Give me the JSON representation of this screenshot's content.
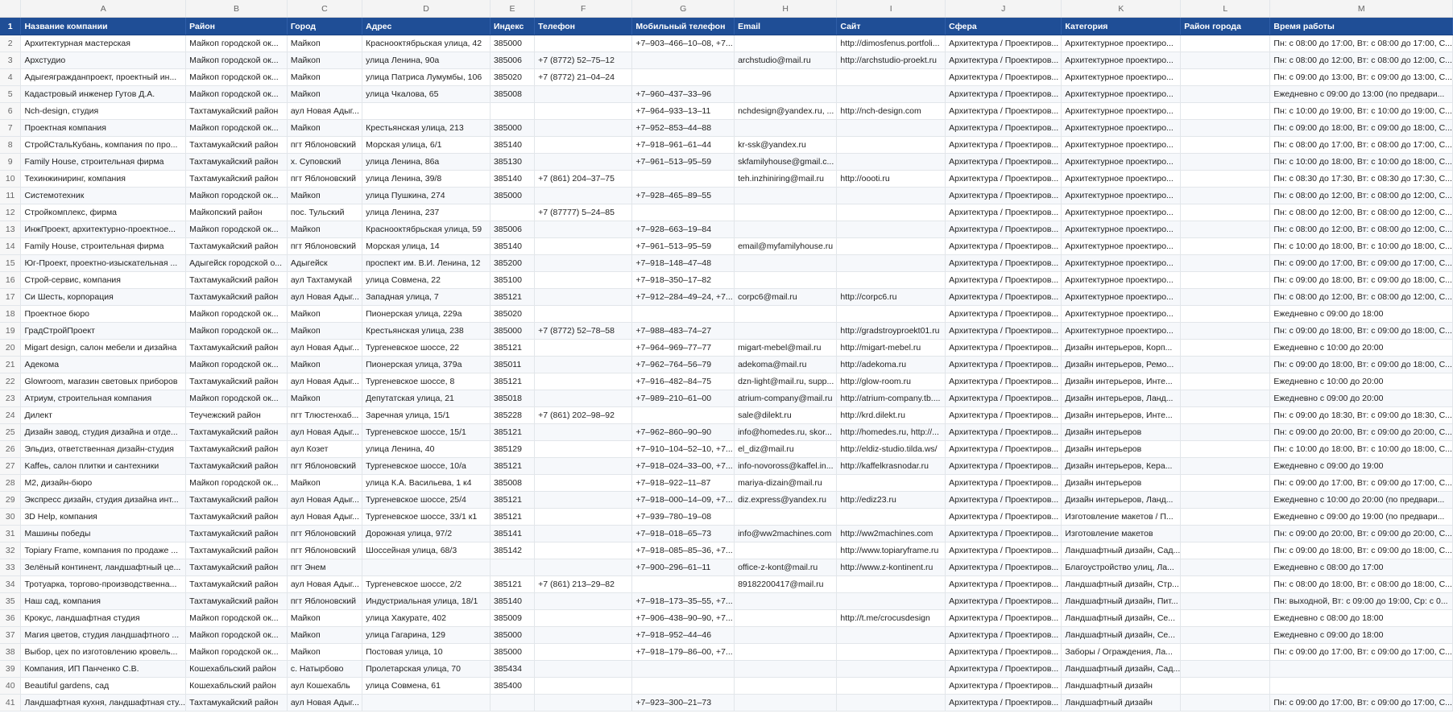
{
  "columns": [
    "A",
    "B",
    "C",
    "D",
    "E",
    "F",
    "G",
    "H",
    "I",
    "J",
    "K",
    "L",
    "M"
  ],
  "header_row_number": "1",
  "headers": [
    "Название компании",
    "Район",
    "Город",
    "Адрес",
    "Индекс",
    "Телефон",
    "Мобильный телефон",
    "Email",
    "Сайт",
    "Сфера",
    "Категория",
    "Район города",
    "Время работы"
  ],
  "rows": [
    [
      "2",
      "Архитектурная мастерская",
      "Майкоп городской ок...",
      "Майкоп",
      "Краснооктябрьская улица, 42",
      "385000",
      "",
      "+7‒903‒466‒10‒08, +7...",
      "",
      "http://dimosfenus.portfoli...",
      "Архитектура / Проектиров...",
      "Архитектурное проектиро...",
      "",
      "Пн: с 08:00 до 17:00, Вт: с 08:00 до 17:00, С..."
    ],
    [
      "3",
      "Архстудио",
      "Майкоп городской ок...",
      "Майкоп",
      "улица Ленина, 90а",
      "385006",
      "+7 (8772) 52‒75‒12",
      "",
      "archstudio@mail.ru",
      "http://archstudio-proekt.ru",
      "Архитектура / Проектиров...",
      "Архитектурное проектиро...",
      "",
      "Пн: с 08:00 до 12:00, Вт: с 08:00 до 12:00, С..."
    ],
    [
      "4",
      "Адыгеягражданпроект, проектный ин...",
      "Майкоп городской ок...",
      "Майкоп",
      "улица Патриса Лумумбы, 106",
      "385020",
      "+7 (8772) 21‒04‒24",
      "",
      "",
      "",
      "Архитектура / Проектиров...",
      "Архитектурное проектиро...",
      "",
      "Пн: с 09:00 до 13:00, Вт: с 09:00 до 13:00, С..."
    ],
    [
      "5",
      "Кадастровый инженер Гутов Д.А.",
      "Майкоп городской ок...",
      "Майкоп",
      "улица Чкалова, 65",
      "385008",
      "",
      "+7‒960‒437‒33‒96",
      "",
      "",
      "Архитектура / Проектиров...",
      "Архитектурное проектиро...",
      "",
      "Ежедневно с 09:00 до 13:00 (по предвари..."
    ],
    [
      "6",
      "Nch-design, студия",
      "Тахтамукайский район",
      "аул Новая Адыг...",
      "",
      "",
      "",
      "+7‒964‒933‒13‒11",
      "nchdesign@yandex.ru, ...",
      "http://nch-design.com",
      "Архитектура / Проектиров...",
      "Архитектурное проектиро...",
      "",
      "Пн: с 10:00 до 19:00, Вт: с 10:00 до 19:00, С..."
    ],
    [
      "7",
      "Проектная компания",
      "Майкоп городской ок...",
      "Майкоп",
      "Крестьянская улица, 213",
      "385000",
      "",
      "+7‒952‒853‒44‒88",
      "",
      "",
      "Архитектура / Проектиров...",
      "Архитектурное проектиро...",
      "",
      "Пн: с 09:00 до 18:00, Вт: с 09:00 до 18:00, С..."
    ],
    [
      "8",
      "СтройСтальКубань, компания по про...",
      "Тахтамукайский район",
      "пгт Яблоновский",
      "Морская улица, 6/1",
      "385140",
      "",
      "+7‒918‒961‒61‒44",
      "kr-ssk@yandex.ru",
      "",
      "Архитектура / Проектиров...",
      "Архитектурное проектиро...",
      "",
      "Пн: с 08:00 до 17:00, Вт: с 08:00 до 17:00, С..."
    ],
    [
      "9",
      "Family House, строительная фирма",
      "Тахтамукайский район",
      "х. Суповский",
      "улица Ленина, 86а",
      "385130",
      "",
      "+7‒961‒513‒95‒59",
      "skfamilyhouse@gmail.c...",
      "",
      "Архитектура / Проектиров...",
      "Архитектурное проектиро...",
      "",
      "Пн: с 10:00 до 18:00, Вт: с 10:00 до 18:00, С..."
    ],
    [
      "10",
      "Техинжиниринг, компания",
      "Тахтамукайский район",
      "пгт Яблоновский",
      "улица Ленина, 39/8",
      "385140",
      "+7 (861) 204‒37‒75",
      "",
      "teh.inzhiniring@mail.ru",
      "http://oooti.ru",
      "Архитектура / Проектиров...",
      "Архитектурное проектиро...",
      "",
      "Пн: с 08:30 до 17:30, Вт: с 08:30 до 17:30, С..."
    ],
    [
      "11",
      "Системотехник",
      "Майкоп городской ок...",
      "Майкоп",
      "улица Пушкина, 274",
      "385000",
      "",
      "+7‒928‒465‒89‒55",
      "",
      "",
      "Архитектура / Проектиров...",
      "Архитектурное проектиро...",
      "",
      "Пн: с 08:00 до 12:00, Вт: с 08:00 до 12:00, С..."
    ],
    [
      "12",
      "Стройкомплекс, фирма",
      "Майкопский район",
      "пос. Тульский",
      "улица Ленина, 237",
      "",
      "+7 (87777) 5‒24‒85",
      "",
      "",
      "",
      "Архитектура / Проектиров...",
      "Архитектурное проектиро...",
      "",
      "Пн: с 08:00 до 12:00, Вт: с 08:00 до 12:00, С..."
    ],
    [
      "13",
      "ИнжПроект, архитектурно-проектное...",
      "Майкоп городской ок...",
      "Майкоп",
      "Краснооктябрьская улица, 59",
      "385006",
      "",
      "+7‒928‒663‒19‒84",
      "",
      "",
      "Архитектура / Проектиров...",
      "Архитектурное проектиро...",
      "",
      "Пн: с 08:00 до 12:00, Вт: с 08:00 до 12:00, С..."
    ],
    [
      "14",
      "Family House, строительная фирма",
      "Тахтамукайский район",
      "пгт Яблоновский",
      "Морская улица, 14",
      "385140",
      "",
      "+7‒961‒513‒95‒59",
      "email@myfamilyhouse.ru",
      "",
      "Архитектура / Проектиров...",
      "Архитектурное проектиро...",
      "",
      "Пн: с 10:00 до 18:00, Вт: с 10:00 до 18:00, С..."
    ],
    [
      "15",
      "Юг-Проект, проектно-изыскательная ...",
      "Адыгейск городской о...",
      "Адыгейск",
      "проспект им. В.И. Ленина, 12",
      "385200",
      "",
      "+7‒918‒148‒47‒48",
      "",
      "",
      "Архитектура / Проектиров...",
      "Архитектурное проектиро...",
      "",
      "Пн: с 09:00 до 17:00, Вт: с 09:00 до 17:00, С..."
    ],
    [
      "16",
      "Строй-сервис, компания",
      "Тахтамукайский район",
      "аул Тахтамукай",
      "улица Совмена, 22",
      "385100",
      "",
      "+7‒918‒350‒17‒82",
      "",
      "",
      "Архитектура / Проектиров...",
      "Архитектурное проектиро...",
      "",
      "Пн: с 09:00 до 18:00, Вт: с 09:00 до 18:00, С..."
    ],
    [
      "17",
      "Си Шесть, корпорация",
      "Тахтамукайский район",
      "аул Новая Адыг...",
      "Западная улица, 7",
      "385121",
      "",
      "+7‒912‒284‒49‒24, +7...",
      "corpc6@mail.ru",
      "http://corpc6.ru",
      "Архитектура / Проектиров...",
      "Архитектурное проектиро...",
      "",
      "Пн: с 08:00 до 12:00, Вт: с 08:00 до 12:00, С..."
    ],
    [
      "18",
      "Проектное бюро",
      "Майкоп городской ок...",
      "Майкоп",
      "Пионерская улица, 229а",
      "385020",
      "",
      "",
      "",
      "",
      "Архитектура / Проектиров...",
      "Архитектурное проектиро...",
      "",
      "Ежедневно с 09:00 до 18:00"
    ],
    [
      "19",
      "ГрадСтройПроект",
      "Майкоп городской ок...",
      "Майкоп",
      "Крестьянская улица, 238",
      "385000",
      "+7 (8772) 52‒78‒58",
      "+7‒988‒483‒74‒27",
      "",
      "http://gradstroyproekt01.ru",
      "Архитектура / Проектиров...",
      "Архитектурное проектиро...",
      "",
      "Пн: с 09:00 до 18:00, Вт: с 09:00 до 18:00, С..."
    ],
    [
      "20",
      "Migart design, салон мебели и дизайна",
      "Тахтамукайский район",
      "аул Новая Адыг...",
      "Тургеневское шоссе, 22",
      "385121",
      "",
      "+7‒964‒969‒77‒77",
      "migart-mebel@mail.ru",
      "http://migart-mebel.ru",
      "Архитектура / Проектиров...",
      "Дизайн интерьеров, Корп...",
      "",
      "Ежедневно с 10:00 до 20:00"
    ],
    [
      "21",
      "Адекома",
      "Майкоп городской ок...",
      "Майкоп",
      "Пионерская улица, 379а",
      "385011",
      "",
      "+7‒962‒764‒56‒79",
      "adekoma@mail.ru",
      "http://adekoma.ru",
      "Архитектура / Проектиров...",
      "Дизайн интерьеров, Ремо...",
      "",
      "Пн: с 09:00 до 18:00, Вт: с 09:00 до 18:00, С..."
    ],
    [
      "22",
      "Glowroom, магазин световых приборов",
      "Тахтамукайский район",
      "аул Новая Адыг...",
      "Тургеневское шоссе, 8",
      "385121",
      "",
      "+7‒916‒482‒84‒75",
      "dzn-light@mail.ru, supp...",
      "http://glow-room.ru",
      "Архитектура / Проектиров...",
      "Дизайн интерьеров, Инте...",
      "",
      "Ежедневно с 10:00 до 20:00"
    ],
    [
      "23",
      "Атриум, строительная компания",
      "Майкоп городской ок...",
      "Майкоп",
      "Депутатская улица, 21",
      "385018",
      "",
      "+7‒989‒210‒61‒00",
      "atrium-company@mail.ru",
      "http://atrium-company.tb....",
      "Архитектура / Проектиров...",
      "Дизайн интерьеров, Ланд...",
      "",
      "Ежедневно с 09:00 до 20:00"
    ],
    [
      "24",
      "Дилект",
      "Теучежский район",
      "пгт Тлюстенхаб...",
      "Заречная улица, 15/1",
      "385228",
      "+7 (861) 202‒98‒92",
      "",
      "sale@dilekt.ru",
      "http://krd.dilekt.ru",
      "Архитектура / Проектиров...",
      "Дизайн интерьеров, Инте...",
      "",
      "Пн: с 09:00 до 18:30, Вт: с 09:00 до 18:30, С..."
    ],
    [
      "25",
      "Дизайн завод, студия дизайна и отде...",
      "Тахтамукайский район",
      "аул Новая Адыг...",
      "Тургеневское шоссе, 15/1",
      "385121",
      "",
      "+7‒962‒860‒90‒90",
      "info@homedes.ru, skor...",
      "http://homedes.ru, http://...",
      "Архитектура / Проектиров...",
      "Дизайн интерьеров",
      "",
      "Пн: с 09:00 до 20:00, Вт: с 09:00 до 20:00, С..."
    ],
    [
      "26",
      "Эльдиз, ответственная дизайн-студия",
      "Тахтамукайский район",
      "аул Козет",
      "улица Ленина, 40",
      "385129",
      "",
      "+7‒910‒104‒52‒10, +7...",
      "el_diz@mail.ru",
      "http://eldiz-studio.tilda.ws/",
      "Архитектура / Проектиров...",
      "Дизайн интерьеров",
      "",
      "Пн: с 10:00 до 18:00, Вт: с 10:00 до 18:00, С..."
    ],
    [
      "27",
      "Kaffeь, салон плитки и сантехники",
      "Тахтамукайский район",
      "пгт Яблоновский",
      "Тургеневское шоссе, 10/а",
      "385121",
      "",
      "+7‒918‒024‒33‒00, +7...",
      "info-novoross@kaffel.in...",
      "http://kaffelkrasnodar.ru",
      "Архитектура / Проектиров...",
      "Дизайн интерьеров, Кера...",
      "",
      "Ежедневно с 09:00 до 19:00"
    ],
    [
      "28",
      "М2, дизайн-бюро",
      "Майкоп городской ок...",
      "Майкоп",
      "улица К.А. Васильева, 1 к4",
      "385008",
      "",
      "+7‒918‒922‒11‒87",
      "mariya-dizain@mail.ru",
      "",
      "Архитектура / Проектиров...",
      "Дизайн интерьеров",
      "",
      "Пн: с 09:00 до 17:00, Вт: с 09:00 до 17:00, С..."
    ],
    [
      "29",
      "Экспресс дизайн, студия дизайна инт...",
      "Тахтамукайский район",
      "аул Новая Адыг...",
      "Тургеневское шоссе, 25/4",
      "385121",
      "",
      "+7‒918‒000‒14‒09, +7...",
      "diz.express@yandex.ru",
      "http://ediz23.ru",
      "Архитектура / Проектиров...",
      "Дизайн интерьеров, Ланд...",
      "",
      "Ежедневно с 10:00 до 20:00 (по предвари..."
    ],
    [
      "30",
      "3D Help, компания",
      "Тахтамукайский район",
      "аул Новая Адыг...",
      "Тургеневское шоссе, 33/1 к1",
      "385121",
      "",
      "+7‒939‒780‒19‒08",
      "",
      "",
      "Архитектура / Проектиров...",
      "Изготовление макетов / П...",
      "",
      "Ежедневно с 09:00 до 19:00 (по предвари..."
    ],
    [
      "31",
      "Машины победы",
      "Тахтамукайский район",
      "пгт Яблоновский",
      "Дорожная улица, 97/2",
      "385141",
      "",
      "+7‒918‒018‒65‒73",
      "info@ww2machines.com",
      "http://ww2machines.com",
      "Архитектура / Проектиров...",
      "Изготовление макетов",
      "",
      "Пн: с 09:00 до 20:00, Вт: с 09:00 до 20:00, С..."
    ],
    [
      "32",
      "Topiary Frame, компания по продаже ...",
      "Тахтамукайский район",
      "пгт Яблоновский",
      "Шоссейная улица, 68/3",
      "385142",
      "",
      "+7‒918‒085‒85‒36, +7...",
      "",
      "http://www.topiaryframe.ru",
      "Архитектура / Проектиров...",
      "Ландшафтный дизайн, Сад...",
      "",
      "Пн: с 09:00 до 18:00, Вт: с 09:00 до 18:00, С..."
    ],
    [
      "33",
      "Зелёный континент, ландшафтный це...",
      "Тахтамукайский район",
      "пгт Энем",
      "",
      "",
      "",
      "+7‒900‒296‒61‒11",
      "office-z-kont@mail.ru",
      "http://www.z-kontinent.ru",
      "Архитектура / Проектиров...",
      "Благоустройство улиц, Ла...",
      "",
      "Ежедневно с 08:00 до 17:00"
    ],
    [
      "34",
      "Тротуарка, торгово-производственна...",
      "Тахтамукайский район",
      "аул Новая Адыг...",
      "Тургеневское шоссе, 2/2",
      "385121",
      "+7 (861) 213‒29‒82",
      "",
      "89182200417@mail.ru",
      "",
      "Архитектура / Проектиров...",
      "Ландшафтный дизайн, Стр...",
      "",
      "Пн: с 08:00 до 18:00, Вт: с 08:00 до 18:00, С..."
    ],
    [
      "35",
      "Наш сад, компания",
      "Тахтамукайский район",
      "пгт Яблоновский",
      "Индустриальная улица, 18/1",
      "385140",
      "",
      "+7‒918‒173‒35‒55, +7...",
      "",
      "",
      "Архитектура / Проектиров...",
      "Ландшафтный дизайн, Пит...",
      "",
      "Пн: выходной, Вт: с 09:00 до 19:00, Ср: с 0..."
    ],
    [
      "36",
      "Крокус, ландшафтная студия",
      "Майкоп городской ок...",
      "Майкоп",
      "улица Хакурате, 402",
      "385009",
      "",
      "+7‒906‒438‒90‒90, +7...",
      "",
      "http://t.me/crocusdesign",
      "Архитектура / Проектиров...",
      "Ландшафтный дизайн, Се...",
      "",
      "Ежедневно с 08:00 до 18:00"
    ],
    [
      "37",
      "Магия цветов, студия ландшафтного ...",
      "Майкоп городской ок...",
      "Майкоп",
      "улица Гагарина, 129",
      "385000",
      "",
      "+7‒918‒952‒44‒46",
      "",
      "",
      "Архитектура / Проектиров...",
      "Ландшафтный дизайн, Се...",
      "",
      "Ежедневно с 09:00 до 18:00"
    ],
    [
      "38",
      "Выбор, цех по изготовлению кровель...",
      "Майкоп городской ок...",
      "Майкоп",
      "Постовая улица, 10",
      "385000",
      "",
      "+7‒918‒179‒86‒00, +7...",
      "",
      "",
      "Архитектура / Проектиров...",
      "Заборы / Ограждения, Ла...",
      "",
      "Пн: с 09:00 до 17:00, Вт: с 09:00 до 17:00, С..."
    ],
    [
      "39",
      "Компания, ИП Панченко С.В.",
      "Кошехабльский район",
      "с. Натырбово",
      "Пролетарская улица, 70",
      "385434",
      "",
      "",
      "",
      "",
      "Архитектура / Проектиров...",
      "Ландшафтный дизайн, Сад...",
      "",
      ""
    ],
    [
      "40",
      "Beautiful gardens, сад",
      "Кошехабльский район",
      "аул Кошехабль",
      "улица Совмена, 61",
      "385400",
      "",
      "",
      "",
      "",
      "Архитектура / Проектиров...",
      "Ландшафтный дизайн",
      "",
      ""
    ],
    [
      "41",
      "Ландшафтная кухня, ландшафтная сту...",
      "Тахтамукайский район",
      "аул Новая Адыг...",
      "",
      "",
      "",
      "+7‒923‒300‒21‒73",
      "",
      "",
      "Архитектура / Проектиров...",
      "Ландшафтный дизайн",
      "",
      "Пн: с 09:00 до 17:00, Вт: с 09:00 до 17:00, С..."
    ]
  ]
}
